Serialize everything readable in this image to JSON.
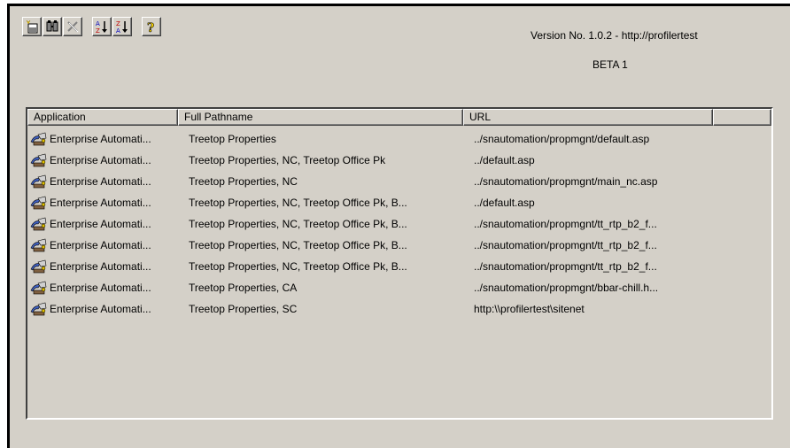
{
  "toolbar": {
    "buttons": [
      {
        "icon": "new-item-icon"
      },
      {
        "icon": "properties-icon"
      },
      {
        "icon": "delete-icon"
      },
      {
        "icon": "sort-ascending-icon"
      },
      {
        "icon": "sort-descending-icon"
      },
      {
        "icon": "help-icon"
      }
    ]
  },
  "version_text": "Version No. 1.0.2 - http://profilertest",
  "beta_text": "BETA 1",
  "list": {
    "columns": [
      "Application",
      "Full Pathname",
      "URL",
      ""
    ],
    "rows": [
      {
        "application": "Enterprise Automati...",
        "pathname": "Treetop Properties",
        "url": "../snautomation/propmgnt/default.asp"
      },
      {
        "application": "Enterprise Automati...",
        "pathname": "Treetop Properties, NC, Treetop Office Pk",
        "url": "../default.asp"
      },
      {
        "application": "Enterprise Automati...",
        "pathname": "Treetop Properties, NC",
        "url": "../snautomation/propmgnt/main_nc.asp"
      },
      {
        "application": "Enterprise Automati...",
        "pathname": "Treetop Properties, NC, Treetop Office Pk, B...",
        "url": "../default.asp"
      },
      {
        "application": "Enterprise Automati...",
        "pathname": "Treetop Properties, NC, Treetop Office Pk, B...",
        "url": "../snautomation/propmgnt/tt_rtp_b2_f..."
      },
      {
        "application": "Enterprise Automati...",
        "pathname": "Treetop Properties, NC, Treetop Office Pk, B...",
        "url": "../snautomation/propmgnt/tt_rtp_b2_f..."
      },
      {
        "application": "Enterprise Automati...",
        "pathname": "Treetop Properties, NC, Treetop Office Pk, B...",
        "url": "../snautomation/propmgnt/tt_rtp_b2_f..."
      },
      {
        "application": "Enterprise Automati...",
        "pathname": "Treetop Properties, CA",
        "url": "../snautomation/propmgnt/bbar-chill.h..."
      },
      {
        "application": "Enterprise Automati...",
        "pathname": "Treetop Properties, SC",
        "url": "http:\\\\profilertest\\sitenet"
      }
    ]
  }
}
